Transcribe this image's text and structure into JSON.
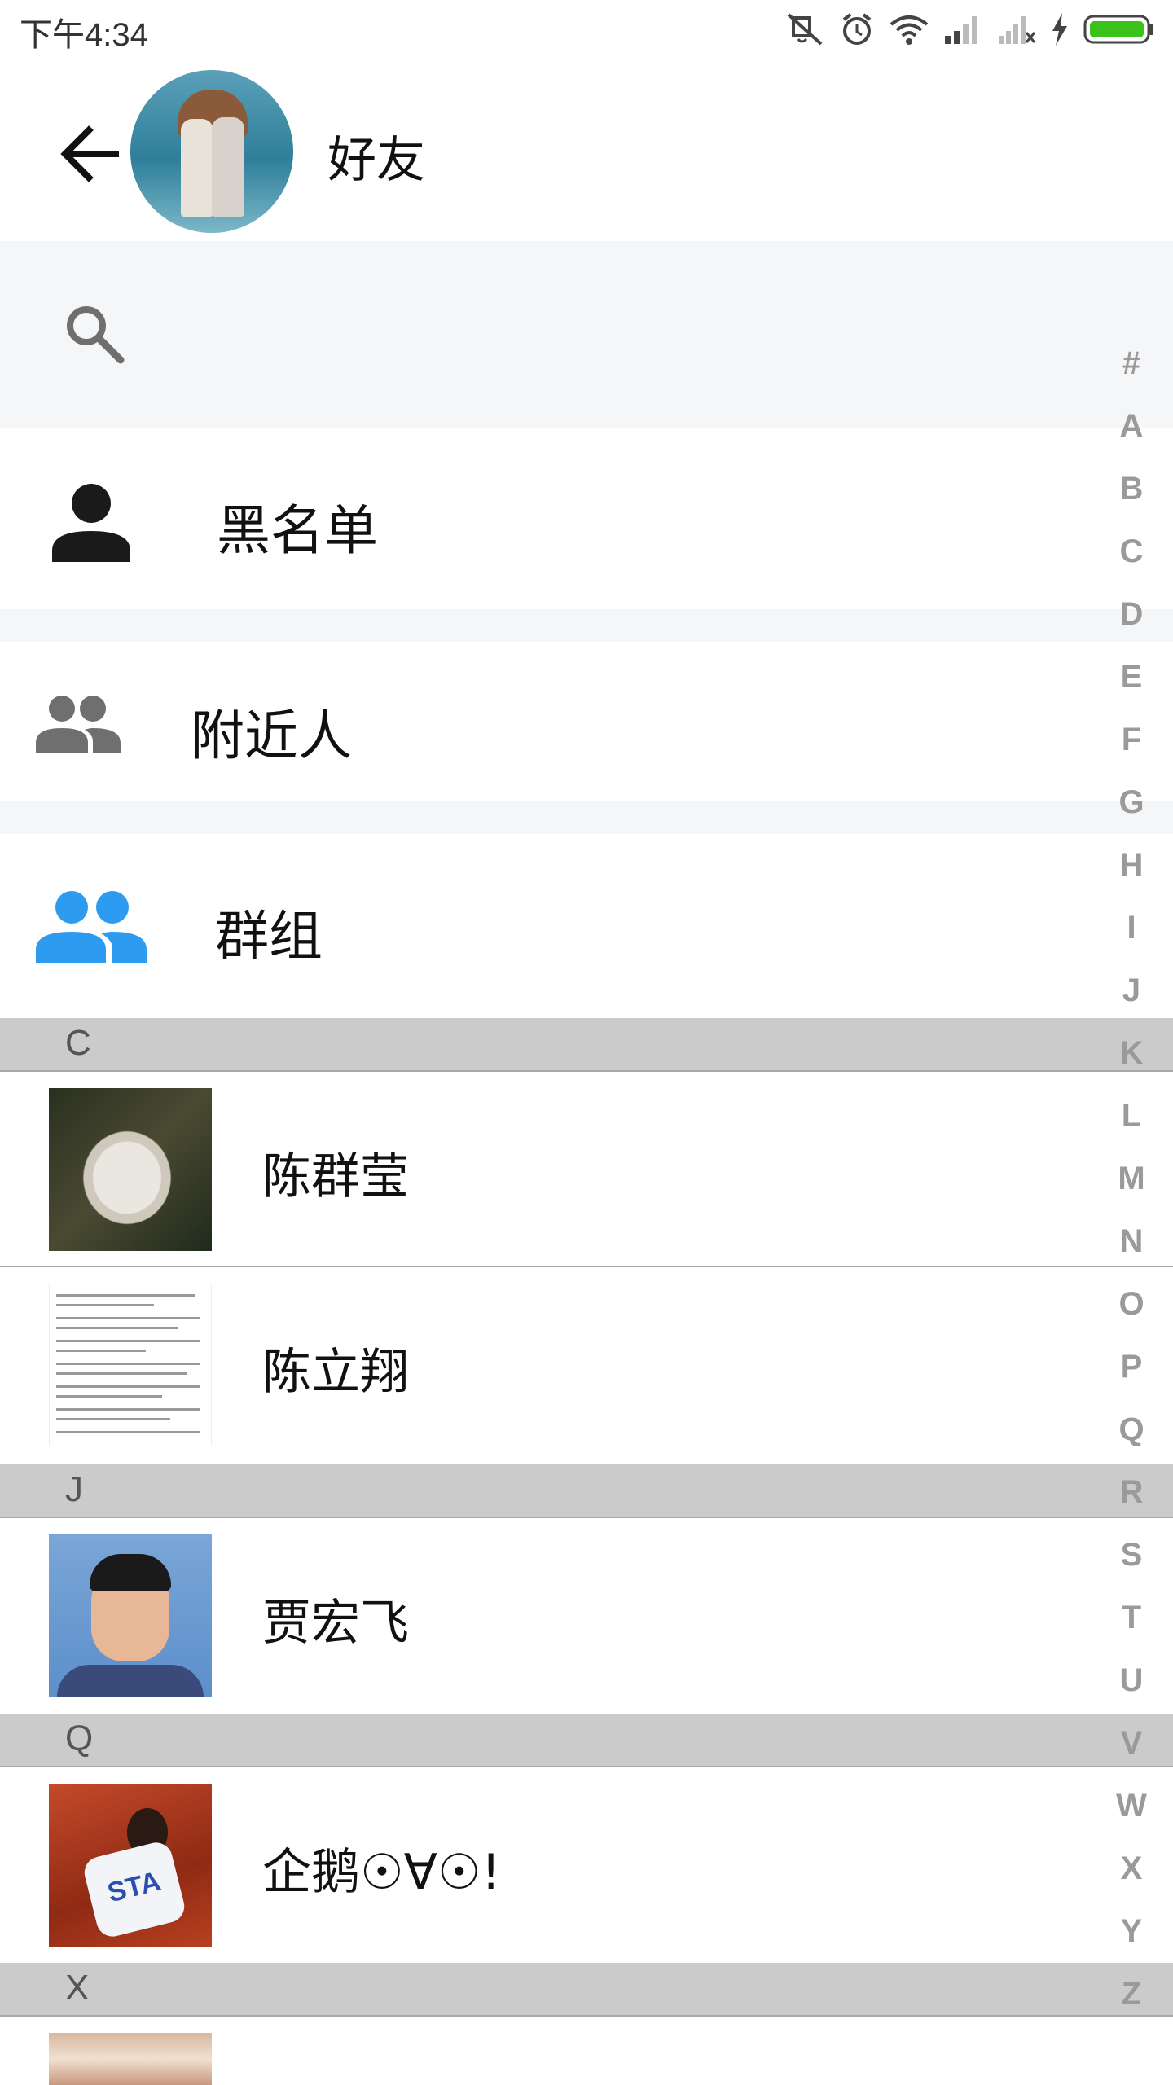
{
  "status_bar": {
    "time": "下午4:34",
    "icons": [
      "mute-icon",
      "alarm-icon",
      "wifi-icon",
      "signal-icon",
      "signal-no-sim-icon",
      "charging-icon",
      "battery-icon"
    ],
    "battery_color": "#3ac21a"
  },
  "header": {
    "title": "好友",
    "back_icon": "arrow-left-icon"
  },
  "search": {
    "placeholder": "",
    "value": ""
  },
  "menu": {
    "blacklist_label": "黑名单",
    "nearby_label": "附近人",
    "groups_label": "群组"
  },
  "sections": [
    {
      "letter": "C",
      "contacts": [
        {
          "name": "陈群莹"
        },
        {
          "name": "陈立翔"
        }
      ]
    },
    {
      "letter": "J",
      "contacts": [
        {
          "name": "贾宏飞"
        }
      ]
    },
    {
      "letter": "Q",
      "contacts": [
        {
          "name": "企鹅☉∀☉!"
        }
      ]
    },
    {
      "letter": "X",
      "contacts": [
        {
          "name": ""
        }
      ]
    }
  ],
  "avatar_text": "STA",
  "alphabet": [
    "#",
    "A",
    "B",
    "C",
    "D",
    "E",
    "F",
    "G",
    "H",
    "I",
    "J",
    "K",
    "L",
    "M",
    "N",
    "O",
    "P",
    "Q",
    "R",
    "S",
    "T",
    "U",
    "V",
    "W",
    "X",
    "Y",
    "Z"
  ],
  "colors": {
    "accent_blue": "#2d9bf0",
    "icon_gray": "#6f6f6f",
    "section_bg": "#cbcbcb",
    "band_bg": "#f5f6f8",
    "index_letter": "#9a9a9a"
  }
}
